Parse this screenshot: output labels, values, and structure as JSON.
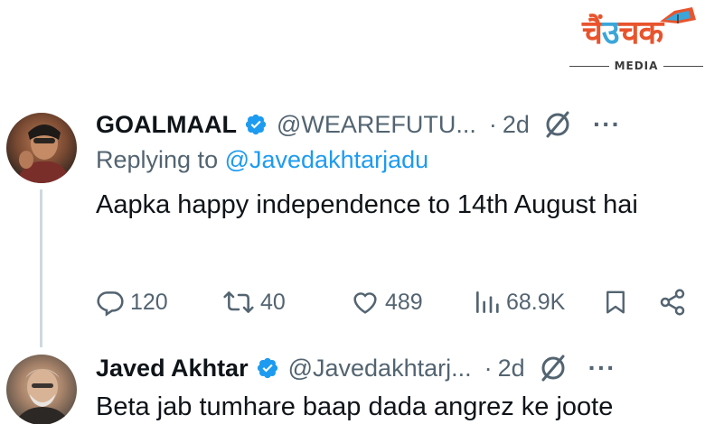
{
  "logo": {
    "chars": [
      "चैं",
      "उ",
      "च",
      "क"
    ],
    "sub": "MEDIA",
    "colors": {
      "orange": "#e8542d",
      "blue": "#3aa6d9"
    }
  },
  "tweets": [
    {
      "name": "GOALMAAL",
      "handle": "@WEAREFUTU...",
      "dot": "·",
      "time": "2d",
      "reply_prefix": "Replying to ",
      "reply_mention": "@Javedakhtarjadu",
      "text": "Aapka happy independence to 14th August hai",
      "actions": {
        "replies": "120",
        "retweets": "40",
        "likes": "489",
        "views": "68.9K"
      },
      "icons": [
        "verified-icon",
        "grok-icon",
        "more-icon",
        "reply-icon",
        "retweet-icon",
        "like-icon",
        "views-icon",
        "bookmark-icon",
        "share-icon"
      ]
    },
    {
      "name": "Javed Akhtar",
      "handle": "@Javedakhtarj...",
      "dot": "·",
      "time": "2d",
      "text": "Beta jab tumhare baap dada angrez ke joote"
    }
  ],
  "colors": {
    "text": "#0f1419",
    "muted": "#536471",
    "link": "#1d9bf0",
    "verified": "#1d9bf0",
    "line": "#cfd9de"
  }
}
